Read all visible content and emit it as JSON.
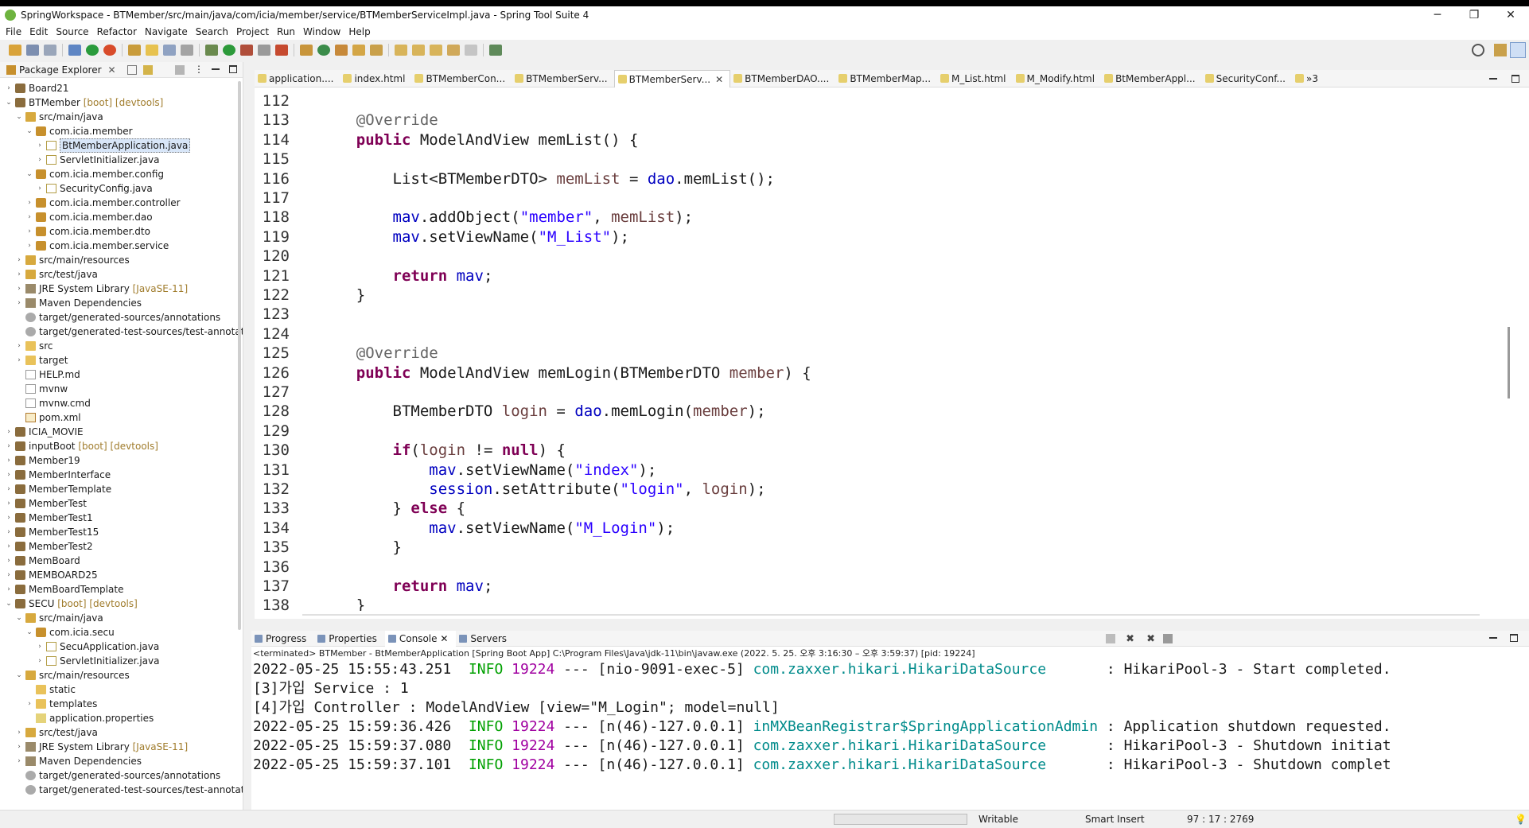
{
  "window": {
    "title": "SpringWorkspace - BTMember/src/main/java/com/icia/member/service/BTMemberServiceImpl.java - Spring Tool Suite 4",
    "controls": [
      "─",
      "❐",
      "✕"
    ]
  },
  "menu": [
    "File",
    "Edit",
    "Source",
    "Refactor",
    "Navigate",
    "Search",
    "Project",
    "Run",
    "Window",
    "Help"
  ],
  "explorer": {
    "title": "Package Explorer",
    "items": [
      {
        "label": "Board21",
        "ann": "",
        "icon": "project-icon"
      },
      {
        "label": "BTMember",
        "ann": "[boot] [devtools]",
        "icon": "project-icon"
      },
      {
        "label": "src/main/java",
        "ann": "",
        "icon": "source-folder-icon"
      },
      {
        "label": "com.icia.member",
        "ann": "",
        "icon": "package-icon"
      },
      {
        "label": "BtMemberApplication.java",
        "ann": "",
        "icon": "java-file-icon"
      },
      {
        "label": "ServletInitializer.java",
        "ann": "",
        "icon": "java-file-icon"
      },
      {
        "label": "com.icia.member.config",
        "ann": "",
        "icon": "package-icon"
      },
      {
        "label": "SecurityConfig.java",
        "ann": "",
        "icon": "java-file-icon"
      },
      {
        "label": "com.icia.member.controller",
        "ann": "",
        "icon": "package-icon"
      },
      {
        "label": "com.icia.member.dao",
        "ann": "",
        "icon": "package-icon"
      },
      {
        "label": "com.icia.member.dto",
        "ann": "",
        "icon": "package-icon"
      },
      {
        "label": "com.icia.member.service",
        "ann": "",
        "icon": "package-icon"
      },
      {
        "label": "src/main/resources",
        "ann": "",
        "icon": "source-folder-icon"
      },
      {
        "label": "src/test/java",
        "ann": "",
        "icon": "source-folder-icon"
      },
      {
        "label": "JRE System Library",
        "ann": "[JavaSE-11]",
        "icon": "library-icon"
      },
      {
        "label": "Maven Dependencies",
        "ann": "",
        "icon": "library-icon"
      },
      {
        "label": "target/generated-sources/annotations",
        "ann": "",
        "icon": "generated-folder-icon"
      },
      {
        "label": "target/generated-test-sources/test-annotatic",
        "ann": "",
        "icon": "generated-folder-icon"
      },
      {
        "label": "src",
        "ann": "",
        "icon": "folder-icon"
      },
      {
        "label": "target",
        "ann": "",
        "icon": "folder-icon"
      },
      {
        "label": "HELP.md",
        "ann": "",
        "icon": "file-icon"
      },
      {
        "label": "mvnw",
        "ann": "",
        "icon": "file-icon"
      },
      {
        "label": "mvnw.cmd",
        "ann": "",
        "icon": "file-icon"
      },
      {
        "label": "pom.xml",
        "ann": "",
        "icon": "xml-file-icon"
      },
      {
        "label": "ICIA_MOVIE",
        "ann": "",
        "icon": "project-icon"
      },
      {
        "label": "inputBoot",
        "ann": "[boot] [devtools]",
        "icon": "project-icon"
      },
      {
        "label": "Member19",
        "ann": "",
        "icon": "project-icon"
      },
      {
        "label": "MemberInterface",
        "ann": "",
        "icon": "project-icon"
      },
      {
        "label": "MemberTemplate",
        "ann": "",
        "icon": "project-icon"
      },
      {
        "label": "MemberTest",
        "ann": "",
        "icon": "project-icon"
      },
      {
        "label": "MemberTest1",
        "ann": "",
        "icon": "project-icon"
      },
      {
        "label": "MemberTest15",
        "ann": "",
        "icon": "project-icon"
      },
      {
        "label": "MemberTest2",
        "ann": "",
        "icon": "project-icon"
      },
      {
        "label": "MemBoard",
        "ann": "",
        "icon": "project-icon"
      },
      {
        "label": "MEMBOARD25",
        "ann": "",
        "icon": "project-icon"
      },
      {
        "label": "MemBoardTemplate",
        "ann": "",
        "icon": "project-icon"
      },
      {
        "label": "SECU",
        "ann": "[boot] [devtools]",
        "icon": "project-icon"
      },
      {
        "label": "src/main/java",
        "ann": "",
        "icon": "source-folder-icon"
      },
      {
        "label": "com.icia.secu",
        "ann": "",
        "icon": "package-icon"
      },
      {
        "label": "SecuApplication.java",
        "ann": "",
        "icon": "java-file-icon"
      },
      {
        "label": "ServletInitializer.java",
        "ann": "",
        "icon": "java-file-icon"
      },
      {
        "label": "src/main/resources",
        "ann": "",
        "icon": "source-folder-icon"
      },
      {
        "label": "static",
        "ann": "",
        "icon": "folder-icon"
      },
      {
        "label": "templates",
        "ann": "",
        "icon": "folder-icon"
      },
      {
        "label": "application.properties",
        "ann": "",
        "icon": "properties-file-icon"
      },
      {
        "label": "src/test/java",
        "ann": "",
        "icon": "source-folder-icon"
      },
      {
        "label": "JRE System Library",
        "ann": "[JavaSE-11]",
        "icon": "library-icon"
      },
      {
        "label": "Maven Dependencies",
        "ann": "",
        "icon": "library-icon"
      },
      {
        "label": "target/generated-sources/annotations",
        "ann": "",
        "icon": "generated-folder-icon"
      },
      {
        "label": "target/generated-test-sources/test-annotatic",
        "ann": "",
        "icon": "generated-folder-icon"
      }
    ]
  },
  "editor": {
    "tabs": [
      "application....",
      "index.html",
      "BTMemberCon...",
      "BTMemberServ...",
      "BTMemberServ...",
      "BTMemberDAO....",
      "BTMemberMap...",
      "M_List.html",
      "M_Modify.html",
      "BtMemberAppl...",
      "SecurityConf...",
      "»3"
    ],
    "active_tab_index": 4,
    "lines": [
      {
        "n": "112",
        "text": ""
      },
      {
        "n": "113",
        "text": "    @Override"
      },
      {
        "n": "114",
        "text": "    public ModelAndView memList() {"
      },
      {
        "n": "115",
        "text": ""
      },
      {
        "n": "116",
        "text": "        List<BTMemberDTO> memList = dao.memList();"
      },
      {
        "n": "117",
        "text": ""
      },
      {
        "n": "118",
        "text": "        mav.addObject(\"member\", memList);"
      },
      {
        "n": "119",
        "text": "        mav.setViewName(\"M_List\");"
      },
      {
        "n": "120",
        "text": ""
      },
      {
        "n": "121",
        "text": "        return mav;"
      },
      {
        "n": "122",
        "text": "    }"
      },
      {
        "n": "123",
        "text": ""
      },
      {
        "n": "124",
        "text": ""
      },
      {
        "n": "125",
        "text": "    @Override"
      },
      {
        "n": "126",
        "text": "    public ModelAndView memLogin(BTMemberDTO member) {"
      },
      {
        "n": "127",
        "text": ""
      },
      {
        "n": "128",
        "text": "        BTMemberDTO login = dao.memLogin(member);"
      },
      {
        "n": "129",
        "text": ""
      },
      {
        "n": "130",
        "text": "        if(login != null) {"
      },
      {
        "n": "131",
        "text": "            mav.setViewName(\"index\");"
      },
      {
        "n": "132",
        "text": "            session.setAttribute(\"login\", login);"
      },
      {
        "n": "133",
        "text": "        } else {"
      },
      {
        "n": "134",
        "text": "            mav.setViewName(\"M_Login\");"
      },
      {
        "n": "135",
        "text": "        }"
      },
      {
        "n": "136",
        "text": ""
      },
      {
        "n": "137",
        "text": "        return mav;"
      },
      {
        "n": "138",
        "text": "    }"
      }
    ]
  },
  "console": {
    "tabs": [
      "Progress",
      "Properties",
      "Console",
      "Servers"
    ],
    "status": "<terminated> BTMember - BtMemberApplication [Spring Boot App] C:\\Program Files\\Java\\jdk-11\\bin\\javaw.exe  (2022. 5. 25. 오후 3:16:30 – 오후 3:59:37) [pid: 19224]",
    "lines": [
      {
        "ts": "2022-05-25 15:55:43.251",
        "lvl": "INFO",
        "pid": "19224",
        "thr": "--- [nio-9091-exec-5]",
        "logger": "com.zaxxer.hikari.HikariDataSource      ",
        "msg": " : HikariPool-3 - Start completed."
      },
      {
        "plain": "[3]가입 Service : 1"
      },
      {
        "plain": "[4]가입 Controller : ModelAndView [view=\"M_Login\"; model=null]"
      },
      {
        "ts": "2022-05-25 15:59:36.426",
        "lvl": "INFO",
        "pid": "19224",
        "thr": "--- [n(46)-127.0.0.1]",
        "logger": "inMXBeanRegistrar$SpringApplicationAdmin",
        "msg": " : Application shutdown requested."
      },
      {
        "ts": "2022-05-25 15:59:37.080",
        "lvl": "INFO",
        "pid": "19224",
        "thr": "--- [n(46)-127.0.0.1]",
        "logger": "com.zaxxer.hikari.HikariDataSource      ",
        "msg": " : HikariPool-3 - Shutdown initiat"
      },
      {
        "ts": "2022-05-25 15:59:37.101",
        "lvl": "INFO",
        "pid": "19224",
        "thr": "--- [n(46)-127.0.0.1]",
        "logger": "com.zaxxer.hikari.HikariDataSource      ",
        "msg": " : HikariPool-3 - Shutdown complet"
      }
    ]
  },
  "statusbar": {
    "mode": "Writable",
    "insert": "Smart Insert",
    "position": "97 : 17 : 2769"
  }
}
